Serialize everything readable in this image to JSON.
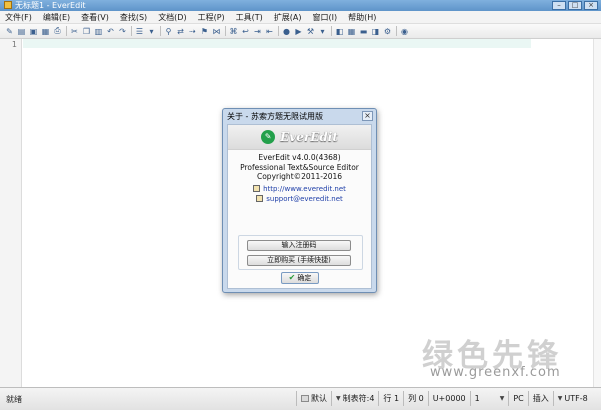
{
  "window": {
    "title": "无标题1 - EverEdit",
    "buttons": [
      "–",
      "□",
      "×"
    ]
  },
  "menu": [
    "文件(F)",
    "编辑(E)",
    "查看(V)",
    "查找(S)",
    "文档(D)",
    "工程(P)",
    "工具(T)",
    "扩展(A)",
    "窗口(I)",
    "帮助(H)"
  ],
  "toolbar_icons": [
    "new",
    "open",
    "save",
    "save-all",
    "print",
    "sep",
    "cut",
    "copy",
    "paste",
    "undo",
    "redo",
    "sep",
    "view-mode",
    "dropdown",
    "sep",
    "find",
    "replace",
    "sep",
    "bookmark",
    "sep",
    "macro",
    "sep",
    "wrap",
    "indent",
    "sep",
    "record",
    "play",
    "sep",
    "tools",
    "sep",
    "panel",
    "panel2",
    "panel3",
    "panel4",
    "sep",
    "help"
  ],
  "editor": {
    "line_number": "1"
  },
  "dialog": {
    "title": "关于 - 苏索方题无限试用版",
    "close": "×",
    "logo_text": "EverEdit",
    "product": "EverEdit v4.0.0(4368)",
    "subtitle": "Professional Text&Source Editor",
    "copyright": "Copyright©2011-2016",
    "website": "http://www.everedit.net",
    "email": "support@everedit.net",
    "register_button": "输入注册码",
    "buy_button": "立即购买 (手续快捷)",
    "ok_button": "确定"
  },
  "status": {
    "ready": "就绪",
    "mode": "默认",
    "tab": "制表符:4",
    "line": "行 1",
    "col": "列 0",
    "unicode": "U+0000",
    "num": "1",
    "eol": "PC",
    "insert": "插入",
    "encoding": "UTF-8"
  },
  "watermark": {
    "logo": "绿色先锋",
    "url": "www.greenxf.com"
  }
}
